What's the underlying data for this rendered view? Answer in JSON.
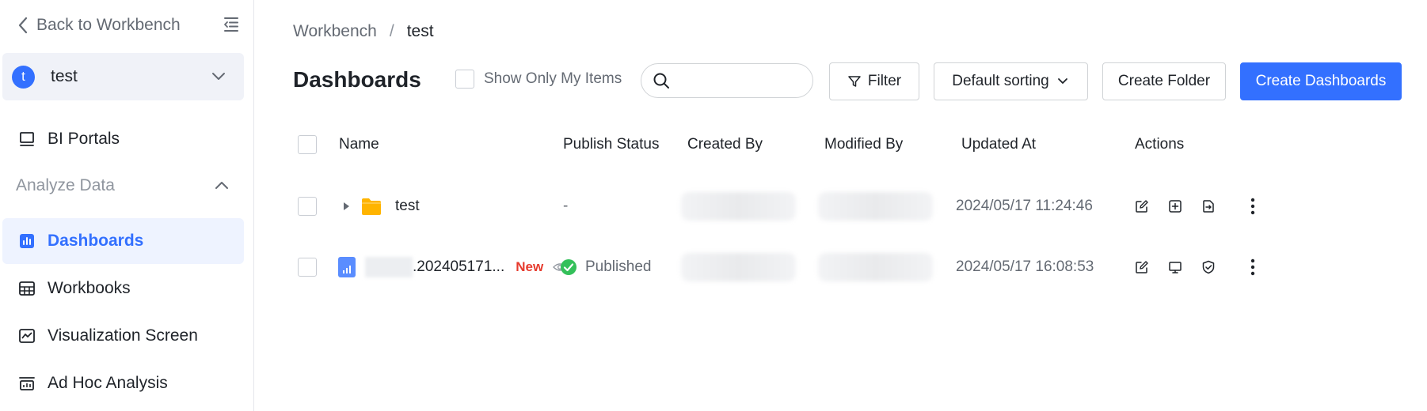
{
  "sidebar": {
    "back_label": "Back to Workbench",
    "workspace": {
      "avatar": "t",
      "name": "test"
    },
    "items": [
      {
        "label": "BI Portals",
        "icon": "monitor-icon"
      },
      {
        "label": "Analyze Data",
        "type": "group"
      },
      {
        "label": "Dashboards",
        "icon": "dashboard-icon",
        "active": true
      },
      {
        "label": "Workbooks",
        "icon": "table-icon"
      },
      {
        "label": "Visualization Screen",
        "icon": "chart-line-icon"
      },
      {
        "label": "Ad Hoc Analysis",
        "icon": "analysis-icon"
      }
    ]
  },
  "breadcrumb": {
    "root": "Workbench",
    "sep": "/",
    "current": "test"
  },
  "toolbar": {
    "title": "Dashboards",
    "show_only_mine": "Show Only My Items",
    "search_placeholder": "",
    "filter": "Filter",
    "sort": "Default sorting",
    "create_folder": "Create Folder",
    "create_dashboards": "Create Dashboards"
  },
  "table": {
    "headers": [
      "Name",
      "Publish Status",
      "Created By",
      "Modified By",
      "Updated At",
      "Actions"
    ],
    "rows": [
      {
        "type": "folder",
        "name": "test",
        "status": "-",
        "updated": "2024/05/17 11:24:46"
      },
      {
        "type": "dashboard",
        "name": ".202405171...",
        "badge": "New",
        "status": "Published",
        "updated": "2024/05/17 16:08:53"
      }
    ]
  },
  "colors": {
    "accent": "#3370ff",
    "folder": "#ffb400",
    "published": "#34c05a",
    "new_badge": "#e63b2e"
  }
}
